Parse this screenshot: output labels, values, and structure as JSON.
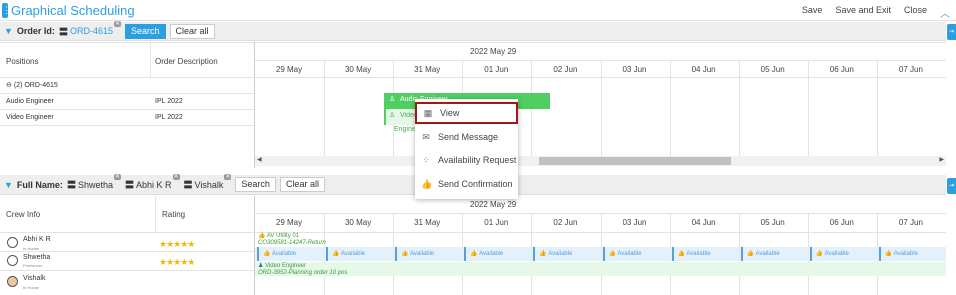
{
  "app": {
    "title": "Graphical Scheduling",
    "actions": [
      "Save",
      "Save and Exit",
      "Close"
    ]
  },
  "positions_panel": {
    "filter": {
      "label": "Order Id:",
      "chip": "ORD-4615",
      "search": "Search",
      "clear": "Clear all"
    },
    "col_positions": "Positions",
    "col_desc": "Order Description",
    "group_row": "(2) ORD-4615",
    "rows": [
      {
        "position": "Audio Engineer",
        "desc": "IPL 2022"
      },
      {
        "position": "Video Engineer",
        "desc": "IPL 2022"
      }
    ],
    "month": "2022 May 29",
    "dates": [
      "29 May",
      "30 May",
      "31 May",
      "01 Jun",
      "02 Jun",
      "03 Jun",
      "04 Jun",
      "05 Jun",
      "06 Jun",
      "07 Jun"
    ],
    "bar_audio": "Audio Engineer",
    "bar_video": "Video Engineer"
  },
  "context_menu": {
    "items": [
      {
        "label": "View",
        "icon": "grid-icon"
      },
      {
        "label": "Send Message",
        "icon": "envelope-icon"
      },
      {
        "label": "Availability Request",
        "icon": "nodes-icon"
      },
      {
        "label": "Send Confirmation",
        "icon": "thumbs-up-icon"
      }
    ]
  },
  "crew_panel": {
    "filter": {
      "label": "Full Name:",
      "chips": [
        "Shwetha",
        "Abhi K R",
        "Vishalk"
      ],
      "search": "Search",
      "clear": "Clear all"
    },
    "col_crew": "Crew Info",
    "col_rating": "Rating",
    "month": "2022 May 29",
    "dates": [
      "29 May",
      "30 May",
      "31 May",
      "01 Jun",
      "02 Jun",
      "03 Jun",
      "04 Jun",
      "05 Jun",
      "06 Jun",
      "07 Jun"
    ],
    "crew": [
      {
        "name": "Abhi K R",
        "role": "In House",
        "rating": 5
      },
      {
        "name": "Shwetha",
        "role": "Freelancer",
        "rating": 5
      },
      {
        "name": "Vishalk",
        "role": "In House",
        "rating": 0
      }
    ],
    "assign1_title": "AV Utility 01",
    "assign1_sub": "CO309581-14247-Return",
    "assign2_title": "Video Engineer",
    "assign2_sub": "ORD-3952-Planning order 10 pos",
    "available_label": "Available"
  },
  "colors": {
    "accent": "#2b9fe0",
    "bar_green": "#4fcf60",
    "star": "#f3b617",
    "menu_highlight": "#a01818"
  }
}
